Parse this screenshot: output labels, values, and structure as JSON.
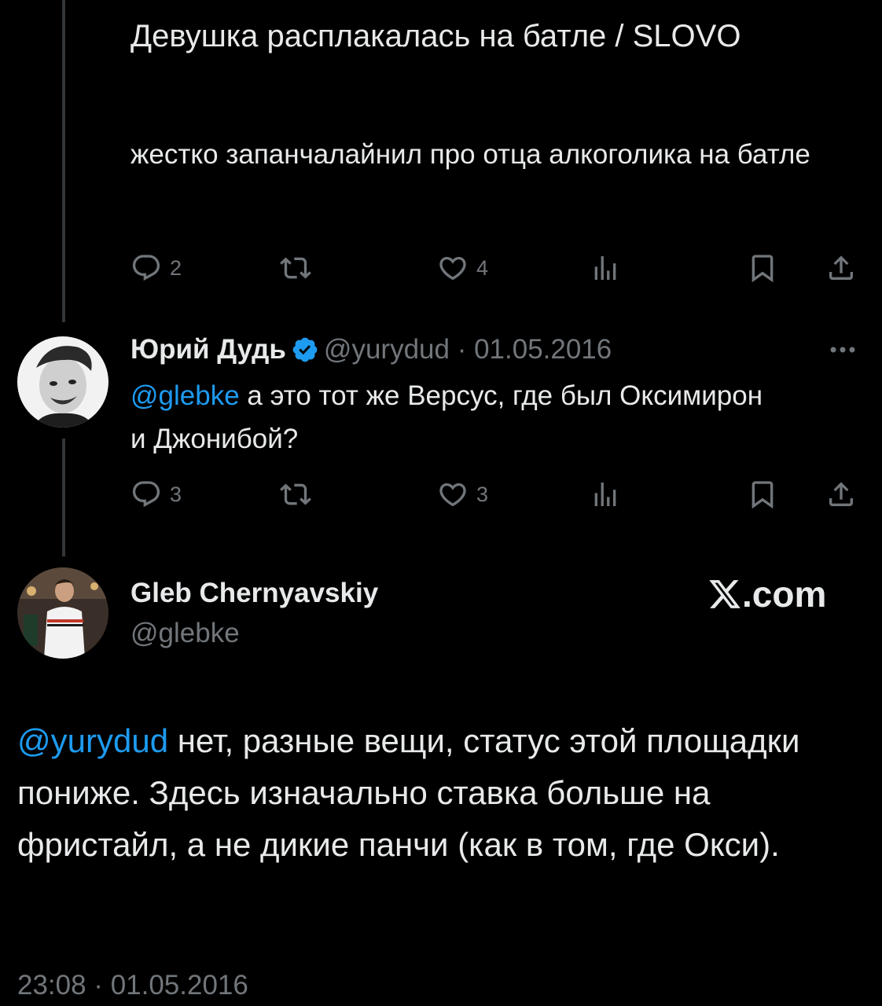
{
  "link_card": {
    "title": "Девушка расплакалась на батле / SLOVO",
    "description": "жестко запанчалайнил про отца алкоголика на батле",
    "actions": {
      "replies": "2",
      "likes": "4"
    }
  },
  "reply_tweet": {
    "name": "Юрий Дудь",
    "handle_date": "@yurydud · 01.05.2016",
    "mention": "@glebke",
    "text": " а это тот же Версус, где был Оксимирон и Джонибой?",
    "actions": {
      "replies": "3",
      "likes": "3"
    }
  },
  "main_tweet": {
    "name": "Gleb Chernyavskiy",
    "handle": "@glebke",
    "brand": ".com",
    "mention": "@yurydud",
    "text": " нет, разные вещи, статус этой площадки пониже. Здесь изначально ставка больше на фристайл, а не дикие панчи (как в том, где Окси).",
    "timestamp": "23:08 · 01.05.2016"
  },
  "icons": [
    "reply-icon",
    "retweet-icon",
    "like-icon",
    "views-icon",
    "bookmark-icon",
    "share-icon",
    "verified-icon",
    "more-icon",
    "x-logo-icon"
  ],
  "colors": {
    "background": "#000000",
    "text": "#e7e9ea",
    "muted": "#71767b",
    "link": "#1d9bf0",
    "thread": "#333639"
  }
}
